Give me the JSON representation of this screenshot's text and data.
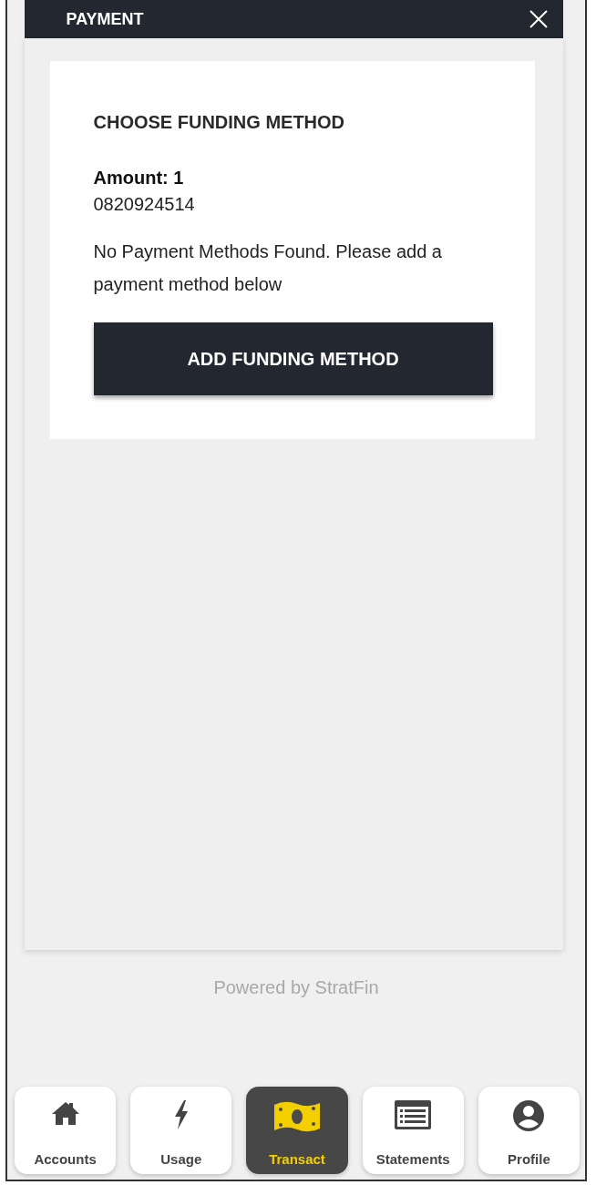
{
  "header": {
    "title": "PAYMENT"
  },
  "card": {
    "heading": "CHOOSE FUNDING METHOD",
    "amount": "Amount: 1",
    "account": "0820924514",
    "message": "No Payment Methods Found. Please add a payment method below",
    "button": "ADD FUNDING METHOD"
  },
  "footer": "Powered by StratFin",
  "nav": [
    {
      "label": "Accounts",
      "selected": false
    },
    {
      "label": "Usage",
      "selected": false
    },
    {
      "label": "Transact",
      "selected": true
    },
    {
      "label": "Statements",
      "selected": false
    },
    {
      "label": "Profile",
      "selected": false
    }
  ]
}
